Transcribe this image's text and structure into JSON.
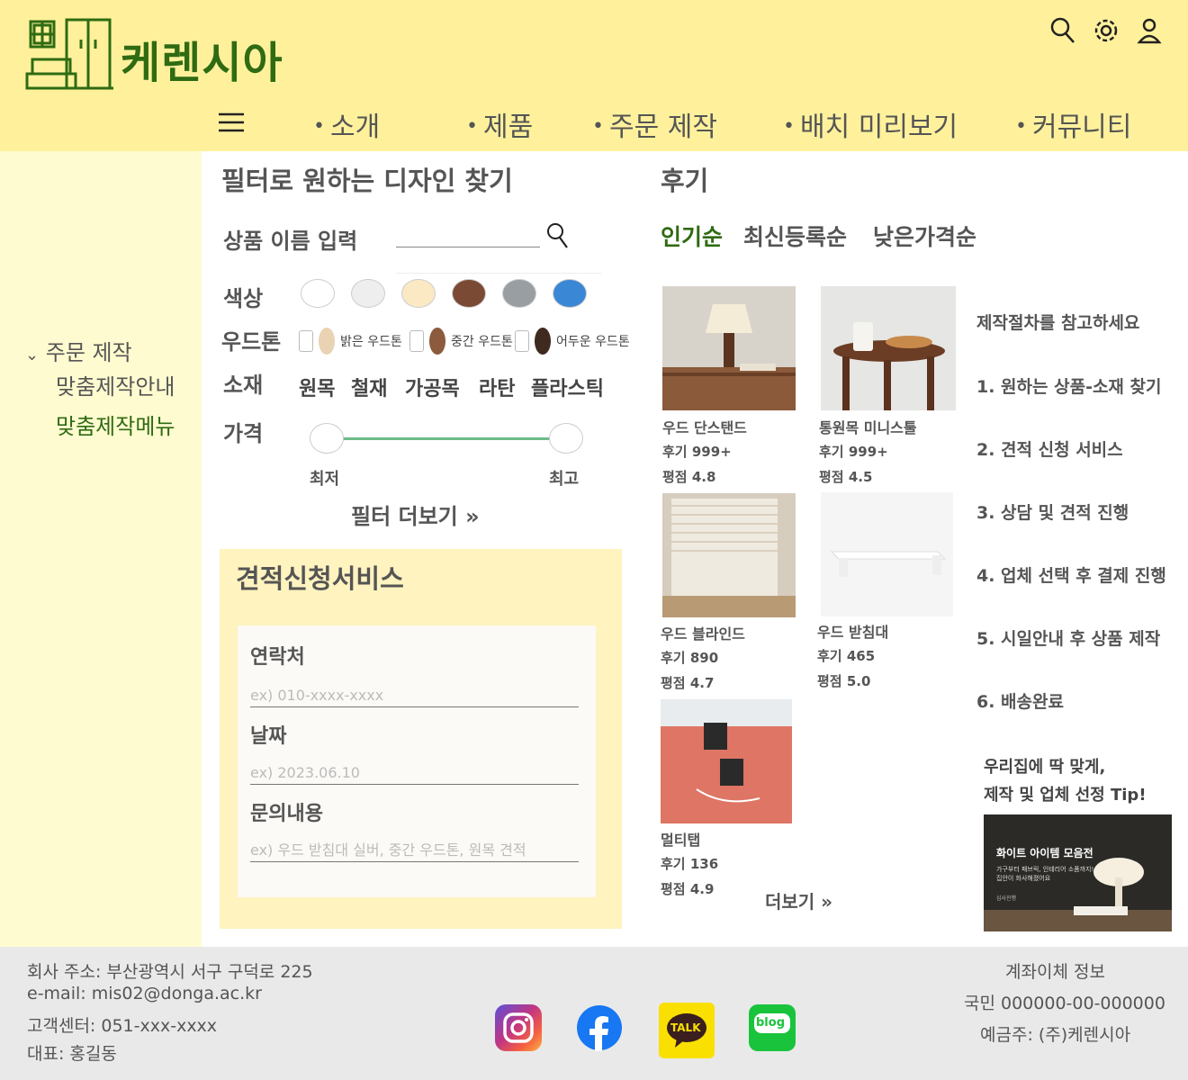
{
  "brand": {
    "name": "케렌시아"
  },
  "header_icons": [
    "search-icon",
    "gear-icon",
    "user-icon"
  ],
  "nav": {
    "items": [
      "소개",
      "제품",
      "주문 제작",
      "배치 미리보기",
      "커뮤니티"
    ]
  },
  "sidebar": {
    "category": "주문 제작",
    "sub_items": [
      "맞춤제작안내",
      "맞춤제작메뉴"
    ],
    "active_sub_color": "#2f6b12"
  },
  "filter": {
    "title": "필터로 원하는 디자인 찾기",
    "search_label": "상품 이름 입력",
    "color_label": "색상",
    "colors": [
      "#ffffff",
      "#eeeeee",
      "#fbe9c3",
      "#7a4a35",
      "#999ea3",
      "#3a87d6"
    ],
    "woodtone_label": "우드톤",
    "woodtones": [
      {
        "label": "밝은 우드톤",
        "color": "#e9d3b3"
      },
      {
        "label": "중간 우드톤",
        "color": "#8c5a3c"
      },
      {
        "label": "어두운 우드톤",
        "color": "#3f2a1f"
      }
    ],
    "material_label": "소재",
    "materials": [
      "원목",
      "철재",
      "가공목",
      "라탄",
      "플라스틱"
    ],
    "price_label": "가격",
    "price_min_label": "최저",
    "price_max_label": "최고",
    "more_label": "필터 더보기"
  },
  "quote": {
    "title": "견적신청서비스",
    "contact_label": "연락처",
    "contact_placeholder": "ex) 010-xxxx-xxxx",
    "date_label": "날짜",
    "date_placeholder": "ex) 2023.06.10",
    "inquiry_label": "문의내용",
    "inquiry_placeholder": "ex) 우드 받침대 실버, 중간 우드톤, 원목 견적"
  },
  "reviews": {
    "title": "후기",
    "tabs": [
      "인기순",
      "최신등록순",
      "낮은가격순"
    ],
    "products": [
      {
        "name": "우드 단스탠드",
        "reviews": "후기 999+",
        "rating": "평점 4.8"
      },
      {
        "name": "통원목 미니스툴",
        "reviews": "후기 999+",
        "rating": "평점 4.5"
      },
      {
        "name": "우드 블라인드",
        "reviews": "후기 890",
        "rating": "평점 4.7"
      },
      {
        "name": "우드 받침대",
        "reviews": "후기 465",
        "rating": "평점 5.0"
      },
      {
        "name": "멀티탭",
        "reviews": "후기 136",
        "rating": "평점 4.9"
      }
    ],
    "more_label": "더보기"
  },
  "process": {
    "title": "제작절차를 참고하세요",
    "steps": [
      "1. 원하는 상품-소재 찾기",
      "2. 견적 신청 서비스",
      "3. 상담 및 견적 진행",
      "4. 업체 선택 후 결제 진행",
      "5. 시일안내 후 상품 제작",
      "6. 배송완료"
    ]
  },
  "tip": {
    "line1": "우리집에 딱 맞게,",
    "line2": "제작 및 업체 선정 Tip!",
    "banner_title": "화이트 아이템 모음전",
    "banner_sub1": "가구부터 패브릭, 인테리어 소품까지!",
    "banner_sub2": "집안이 화사해졌어요",
    "banner_foot": "심사진행"
  },
  "footer": {
    "address": "회사 주소: 부산광역시 서구 구덕로 225",
    "email": "e-mail: mis02@donga.ac.kr",
    "phone": "고객센터: 051-xxx-xxxx",
    "ceo": "대표: 홍길동",
    "bank_title": "계좌이체 정보",
    "bank_account": "국민 000000-00-000000",
    "bank_holder": "예금주: (주)케렌시아",
    "social": [
      "instagram-icon",
      "facebook-icon",
      "kakaotalk-icon",
      "blog-icon"
    ],
    "kakao_text": "TALK",
    "blog_text": "blog"
  }
}
